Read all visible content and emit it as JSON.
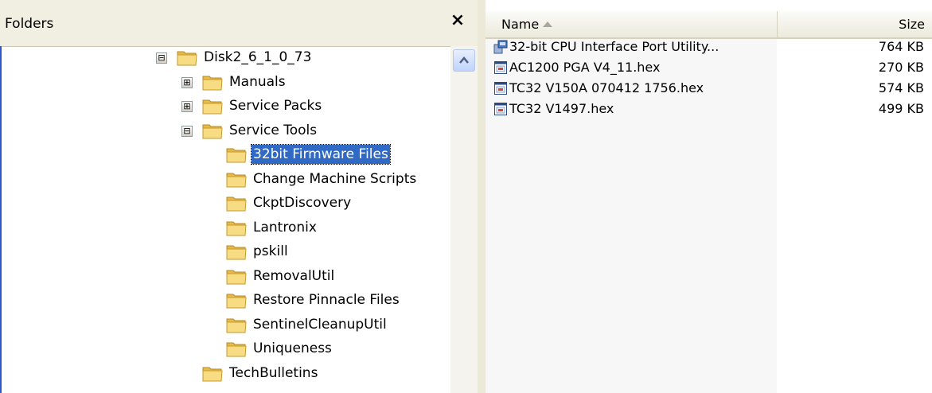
{
  "folders_pane": {
    "title": "Folders",
    "close_glyph": "×",
    "tree": [
      {
        "label": "Disk2_6_1_0_73",
        "expander": "⊟",
        "level": 0,
        "icon": "folder-open-icon"
      },
      {
        "label": "Manuals",
        "expander": "⊞",
        "level": 1,
        "icon": "folder-icon"
      },
      {
        "label": "Service Packs",
        "expander": "⊞",
        "level": 1,
        "icon": "folder-icon"
      },
      {
        "label": "Service Tools",
        "expander": "⊟",
        "level": 1,
        "icon": "folder-open-icon"
      },
      {
        "label": "32bit Firmware Files",
        "expander": "",
        "level": 2,
        "icon": "folder-icon",
        "selected": true
      },
      {
        "label": "Change Machine Scripts",
        "expander": "",
        "level": 2,
        "icon": "folder-icon"
      },
      {
        "label": "CkptDiscovery",
        "expander": "",
        "level": 2,
        "icon": "folder-icon"
      },
      {
        "label": "Lantronix",
        "expander": "",
        "level": 2,
        "icon": "folder-icon"
      },
      {
        "label": "pskill",
        "expander": "",
        "level": 2,
        "icon": "folder-icon"
      },
      {
        "label": "RemovalUtil",
        "expander": "",
        "level": 2,
        "icon": "folder-icon"
      },
      {
        "label": "Restore Pinnacle Files",
        "expander": "",
        "level": 2,
        "icon": "folder-icon"
      },
      {
        "label": "SentinelCleanupUtil",
        "expander": "",
        "level": 2,
        "icon": "folder-icon"
      },
      {
        "label": "Uniqueness",
        "expander": "",
        "level": 2,
        "icon": "folder-icon"
      },
      {
        "label": "TechBulletins",
        "expander": "",
        "level": 1,
        "icon": "folder-icon"
      }
    ]
  },
  "file_list": {
    "columns": {
      "name": "Name",
      "size": "Size"
    },
    "sort_column": "Name",
    "files": [
      {
        "name": "32-bit CPU Interface Port Utility...",
        "size": "764 KB",
        "icon": "installer-icon"
      },
      {
        "name": "AC1200 PGA V4_11.hex",
        "size": "270 KB",
        "icon": "hex-file-icon"
      },
      {
        "name": "TC32 V150A 070412 1756.hex",
        "size": "574 KB",
        "icon": "hex-file-icon"
      },
      {
        "name": "TC32 V1497.hex",
        "size": "499 KB",
        "icon": "hex-file-icon"
      }
    ]
  },
  "colors": {
    "selection": "#316ac5",
    "header_bg": "#f1efe2",
    "folder_yellow": "#f5d26a",
    "pane_border": "#2f59c1"
  }
}
